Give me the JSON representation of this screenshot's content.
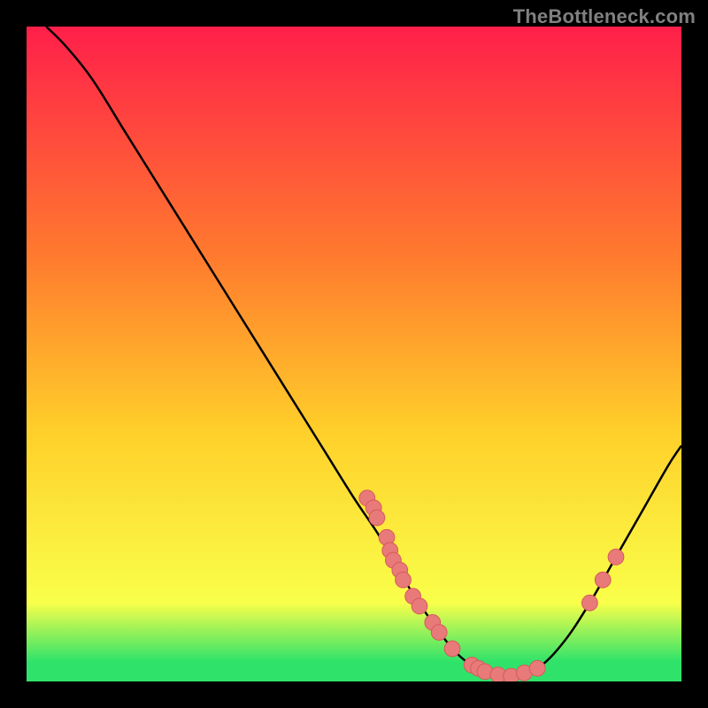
{
  "watermark": "TheBottleneck.com",
  "colors": {
    "background": "#000000",
    "grad_top": "#ff1f4a",
    "grad_upper_mid": "#ff7a2e",
    "grad_mid": "#ffd02a",
    "grad_lower_mid": "#f9ff4a",
    "grad_green": "#2fe36a",
    "curve": "#000000",
    "point_fill": "#e97a7a",
    "point_stroke": "#d55b5b"
  },
  "chart_data": {
    "type": "line",
    "title": "",
    "xlabel": "",
    "ylabel": "",
    "xlim": [
      0,
      100
    ],
    "ylim": [
      0,
      100
    ],
    "curve": [
      {
        "x": 3,
        "y": 100
      },
      {
        "x": 6,
        "y": 97
      },
      {
        "x": 10,
        "y": 92
      },
      {
        "x": 15,
        "y": 84
      },
      {
        "x": 20,
        "y": 76
      },
      {
        "x": 25,
        "y": 68
      },
      {
        "x": 30,
        "y": 60
      },
      {
        "x": 35,
        "y": 52
      },
      {
        "x": 40,
        "y": 44
      },
      {
        "x": 45,
        "y": 36
      },
      {
        "x": 50,
        "y": 28
      },
      {
        "x": 54,
        "y": 22
      },
      {
        "x": 58,
        "y": 15
      },
      {
        "x": 62,
        "y": 9
      },
      {
        "x": 66,
        "y": 4
      },
      {
        "x": 70,
        "y": 1.5
      },
      {
        "x": 74,
        "y": 0.8
      },
      {
        "x": 78,
        "y": 2
      },
      {
        "x": 82,
        "y": 6
      },
      {
        "x": 86,
        "y": 12
      },
      {
        "x": 90,
        "y": 19
      },
      {
        "x": 94,
        "y": 26
      },
      {
        "x": 98,
        "y": 33
      },
      {
        "x": 100,
        "y": 36
      }
    ],
    "points": [
      {
        "x": 52,
        "y": 28
      },
      {
        "x": 53,
        "y": 26.5
      },
      {
        "x": 53.5,
        "y": 25
      },
      {
        "x": 55,
        "y": 22
      },
      {
        "x": 55.5,
        "y": 20
      },
      {
        "x": 56,
        "y": 18.5
      },
      {
        "x": 57,
        "y": 17
      },
      {
        "x": 57.5,
        "y": 15.5
      },
      {
        "x": 59,
        "y": 13
      },
      {
        "x": 60,
        "y": 11.5
      },
      {
        "x": 62,
        "y": 9
      },
      {
        "x": 63,
        "y": 7.5
      },
      {
        "x": 65,
        "y": 5
      },
      {
        "x": 68,
        "y": 2.5
      },
      {
        "x": 69,
        "y": 2
      },
      {
        "x": 70,
        "y": 1.5
      },
      {
        "x": 72,
        "y": 1
      },
      {
        "x": 74,
        "y": 0.8
      },
      {
        "x": 76,
        "y": 1.3
      },
      {
        "x": 78,
        "y": 2
      },
      {
        "x": 86,
        "y": 12
      },
      {
        "x": 88,
        "y": 15.5
      },
      {
        "x": 90,
        "y": 19
      }
    ],
    "point_radius_data_units": 1.2,
    "gradient_stops": [
      {
        "offset": 0.0,
        "key": "grad_top"
      },
      {
        "offset": 0.35,
        "key": "grad_upper_mid"
      },
      {
        "offset": 0.62,
        "key": "grad_mid"
      },
      {
        "offset": 0.88,
        "key": "grad_lower_mid"
      },
      {
        "offset": 0.97,
        "key": "grad_green"
      },
      {
        "offset": 1.0,
        "key": "grad_green"
      }
    ]
  }
}
